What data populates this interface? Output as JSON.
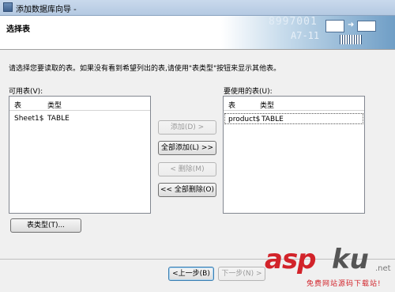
{
  "window": {
    "title": "添加数据库向导 -",
    "icon": "database-wizard-icon"
  },
  "banner": {
    "title": "选择表",
    "art_numbers": [
      "8997001",
      "A7-11"
    ]
  },
  "instructions": "请选择您要读取的表。如果没有看到希望列出的表,请使用\"表类型\"按钮来显示其他表。",
  "available": {
    "label": "可用表(V):",
    "columns": [
      "表",
      "类型"
    ],
    "rows": [
      {
        "table": "Sheet1$",
        "type": "TABLE"
      }
    ]
  },
  "selected": {
    "label": "要使用的表(U):",
    "columns": [
      "表",
      "类型"
    ],
    "rows": [
      {
        "table": "product$",
        "type": "TABLE"
      }
    ]
  },
  "buttons": {
    "add": "添加(D) >",
    "add_all": "全部添加(L) >>",
    "remove": "< 删除(M)",
    "remove_all": "<< 全部删除(O)",
    "table_type": "表类型(T)...",
    "back": "<上一步(B)",
    "next": "下一步(N) >"
  },
  "watermark": {
    "brand_a": "asp",
    "brand_b": "ku",
    "tld": ".net",
    "tagline": "免费网站源码下载站!"
  }
}
